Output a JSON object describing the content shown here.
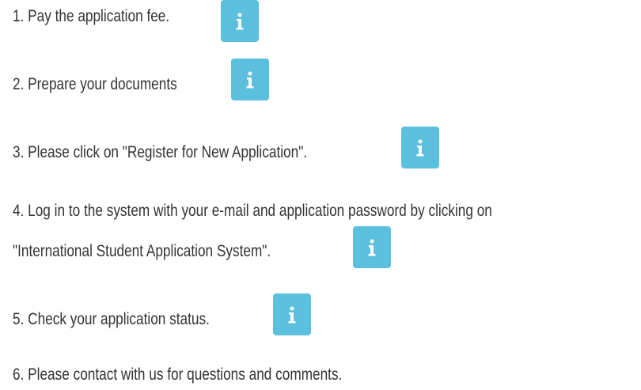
{
  "steps": [
    {
      "text": "1. Pay the application fee.",
      "has_info": true
    },
    {
      "text": "2. Prepare your documents",
      "has_info": true
    },
    {
      "text": "3. Please click on \"Register for New Application\".",
      "has_info": true
    },
    {
      "text": "4. Log in to the system with your e-mail and application password by clicking on",
      "has_info": false
    },
    {
      "text": "\"International Student Application System\".",
      "has_info": true
    },
    {
      "text": "5. Check your application status.",
      "has_info": true
    },
    {
      "text": "6. Please contact with us for questions and comments.",
      "has_info": false
    }
  ],
  "icons": {
    "info": "info-icon"
  },
  "colors": {
    "info_button": "#5bc0de",
    "text": "#333333"
  }
}
